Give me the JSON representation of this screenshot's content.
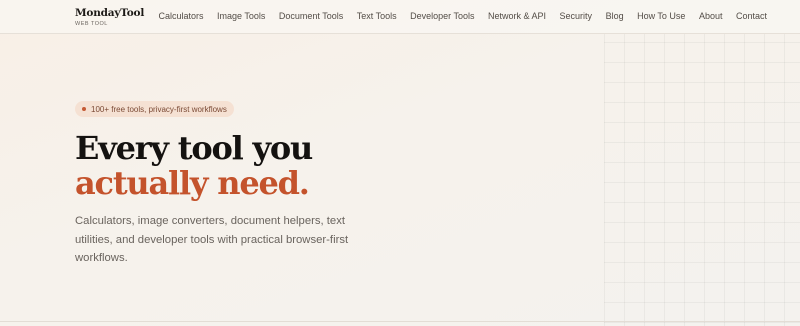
{
  "brand": {
    "name": "MondayTool",
    "subtitle": "WEB TOOL"
  },
  "nav": {
    "items": [
      "Calculators",
      "Image Tools",
      "Document Tools",
      "Text Tools",
      "Developer Tools",
      "Network & API",
      "Security",
      "Blog",
      "How To Use",
      "About",
      "Contact"
    ]
  },
  "hero": {
    "badge": "100+ free tools, privacy-first workflows",
    "headline_line1": "Every tool you",
    "headline_line2": "actually need.",
    "description": "Calculators, image converters, document helpers, text utilities, and developer tools with practical browser-first workflows."
  },
  "colors": {
    "accent": "#c4532c",
    "background": "#f6f3ee",
    "text": "#141210"
  }
}
